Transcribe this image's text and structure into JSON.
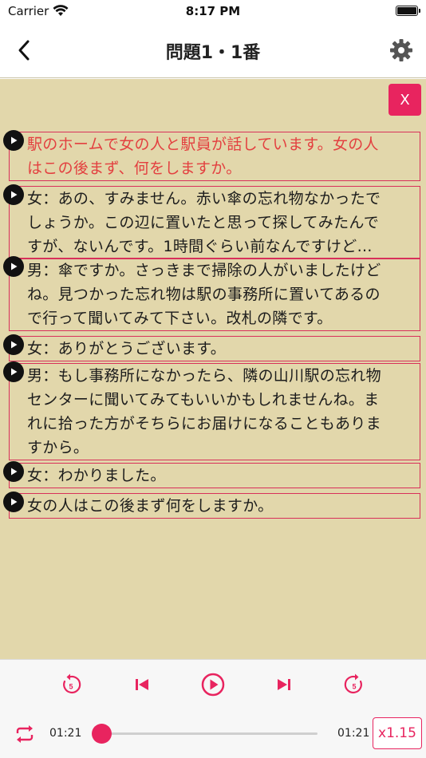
{
  "status": {
    "carrier": "Carrier",
    "time": "8:17 PM"
  },
  "nav": {
    "title": "問題1・1番"
  },
  "close_label": "X",
  "lines": [
    {
      "rows": [
        "駅のホームで女の人と駅員が話しています。女の人",
        "はこの後まず、何をしますか。"
      ],
      "active": true
    },
    {
      "rows": [
        "女：あの、すみません。赤い傘の忘れ物なかったで",
        "しょうか。この辺に置いたと思って探してみたんで",
        "すが、ないんです。1時間ぐらい前なんですけど…"
      ]
    },
    {
      "rows": [
        "男：傘ですか。さっきまで掃除の人がいましたけど",
        "ね。見つかった忘れ物は駅の事務所に置いてあるの",
        "で行って聞いてみて下さい。改札の隣です。"
      ]
    },
    {
      "rows": [
        "女：ありがとうございます。"
      ]
    },
    {
      "rows": [
        "男：もし事務所になかったら、隣の山川駅の忘れ物",
        "センターに聞いてみてもいいかもしれませんね。ま",
        "れに拾った方がそちらにお届けになることもありま",
        "すから。"
      ]
    },
    {
      "rows": [
        "女：わかりました。"
      ]
    },
    {
      "rows": [
        "女の人はこの後まず何をしますか。"
      ]
    }
  ],
  "player": {
    "current_time": "01:21",
    "total_time": "01:21",
    "speed_label": "x1.15",
    "rewind_seconds": "5",
    "forward_seconds": "5",
    "progress": 0.0,
    "accent": "#e8245f"
  },
  "colors": {
    "background": "#e2d7ab",
    "border": "#d8305a",
    "active_text": "#e34040"
  },
  "icons": [
    "wifi-icon",
    "battery-icon",
    "back-chevron-icon",
    "gear-icon",
    "play-icon",
    "rewind-5-icon",
    "skip-previous-icon",
    "play-circle-icon",
    "skip-next-icon",
    "forward-5-icon",
    "repeat-icon"
  ]
}
